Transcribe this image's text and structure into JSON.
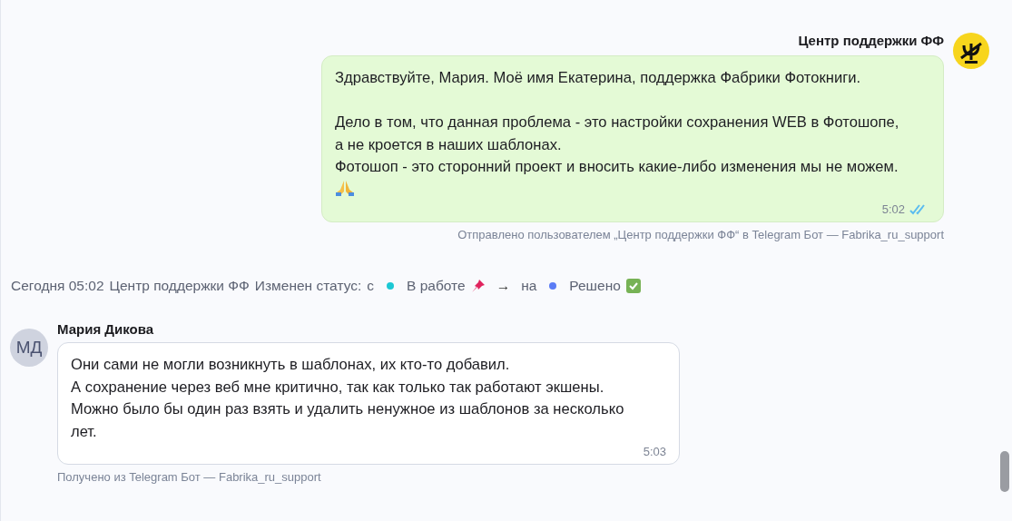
{
  "messages": [
    {
      "kind": "outgoing",
      "sender": "Центр поддержки ФФ",
      "logo": true,
      "text": "Здравствуйте, Мария. Моё имя Екатерина, поддержка Фабрики Фотокниги.\n\nДело в том, что данная проблема - это настройки сохранения WEB в Фотошопе, а не кроется в наших шаблонах.\nФотошоп - это сторонний проект и вносить какие-либо изменения мы не можем.",
      "time": "5:02",
      "read": true,
      "footer": "Отправлено пользователем „Центр поддержки ФФ“ в Telegram Бот — Fabrika_ru_support"
    },
    {
      "kind": "status",
      "date": "Сегодня 05:02",
      "author": "Центр поддержки ФФ",
      "action": "Изменен статус:",
      "from_word": "с",
      "from": {
        "label": "В работе",
        "color": "#1cc8d4"
      },
      "arrow": "→",
      "to_word": "на",
      "to": {
        "label": "Решено",
        "color": "#5b7cf5"
      }
    },
    {
      "kind": "incoming",
      "sender": "Мария Дикова",
      "avatar": "МД",
      "text": "Они сами не могли возникнуть в шаблонах, их кто-то добавил.\nА сохранение через веб мне критично, так как только так работают экшены.\nМожно было бы один раз взять и удалить ненужное из шаблонов за несколько лет.",
      "time": "5:03",
      "footer": "Получено из Telegram Бот — Fabrika_ru_support"
    }
  ]
}
